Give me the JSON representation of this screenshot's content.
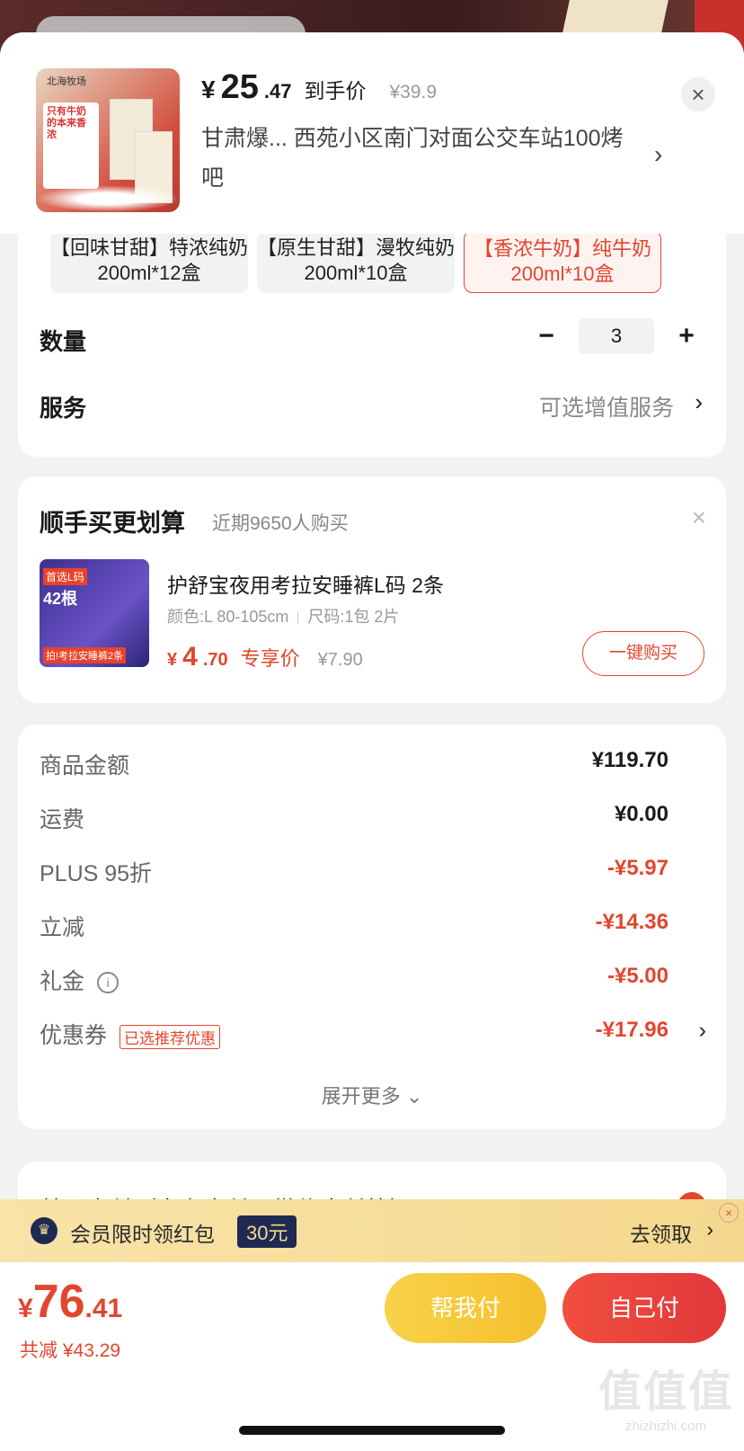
{
  "product": {
    "image_brand": "北海牧场",
    "image_caption": "只有牛奶的本来香浓",
    "price_currency": "¥",
    "price_int": "25",
    "price_dec": ".47",
    "price_label": "到手价",
    "original_price": "¥39.9",
    "address": "甘肃爆... 西苑小区南门对面公交车站100烤吧"
  },
  "variants": [
    {
      "label": "【回味甘甜】特浓纯奶200ml*12盒",
      "selected": false
    },
    {
      "label": "【原生甘甜】漫牧纯奶200ml*10盒",
      "selected": false
    },
    {
      "label": "【香浓牛奶】纯牛奶200ml*10盒",
      "selected": true
    }
  ],
  "quantity": {
    "label": "数量",
    "minus": "−",
    "value": "3",
    "plus": "+"
  },
  "service": {
    "label": "服务",
    "value": "可选增值服务",
    "chevron": "›"
  },
  "upsell": {
    "title": "顺手买更划算",
    "subtitle": "近期9650人购买",
    "close": "×",
    "thumb_badge_top": "首选L码",
    "thumb_badge_mid": "42根",
    "thumb_badge_bottom": "拍!考拉安睡裤2条",
    "name": "护舒宝夜用考拉安睡裤L码 2条",
    "spec_color": "颜色:L 80-105cm",
    "spec_size": "尺码:1包 2片",
    "price_currency": "¥",
    "price_int": "4",
    "price_dec": ".70",
    "price_label": "专享价",
    "original_price": "¥7.90",
    "buy_label": "一键购买"
  },
  "summary": {
    "rows": [
      {
        "label": "商品金额",
        "value": "¥119.70",
        "red": false
      },
      {
        "label": "运费",
        "value": "¥0.00",
        "red": false
      },
      {
        "label": "PLUS 95折",
        "value": "-¥5.97",
        "red": true
      },
      {
        "label": "立减",
        "value": "-¥14.36",
        "red": true
      },
      {
        "label": "礼金",
        "value": "-¥5.00",
        "red": true
      },
      {
        "label": "优惠券",
        "value": "-¥17.96",
        "red": true,
        "badge": "已选推荐优惠"
      }
    ],
    "info_icon": "i",
    "expand": "展开更多 ⌄"
  },
  "payment": {
    "label": "普通支付（京东支付、微信支付等）",
    "check": "✓"
  },
  "banner": {
    "text": "会员限时领红包",
    "amount": "30元",
    "action": "去领取",
    "chevron": "›",
    "close": "×"
  },
  "bottom": {
    "currency": "¥",
    "total_int": "76",
    "total_dec": ".41",
    "discount": "共减 ¥43.29",
    "help_pay": "帮我付",
    "self_pay": "自己付",
    "watermark": "值值值",
    "watermark_url": "zhizhizhi.com"
  },
  "colors": {
    "accent": "#e2462d",
    "pay_yellow": "#f4c02c",
    "banner_bg": "#f5d88e",
    "banner_navy": "#1f2a52"
  }
}
